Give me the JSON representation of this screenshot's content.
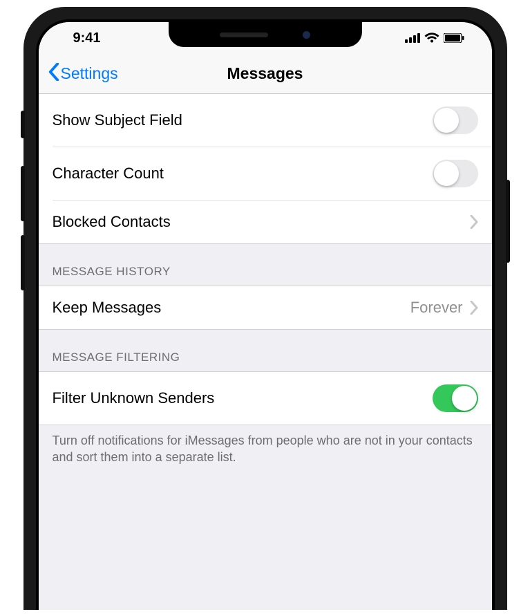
{
  "status": {
    "time": "9:41"
  },
  "nav": {
    "back": "Settings",
    "title": "Messages"
  },
  "group1": {
    "rows": [
      {
        "label": "Show Subject Field",
        "type": "toggle",
        "on": false
      },
      {
        "label": "Character Count",
        "type": "toggle",
        "on": false
      },
      {
        "label": "Blocked Contacts",
        "type": "link"
      }
    ]
  },
  "group2": {
    "header": "MESSAGE HISTORY",
    "rows": [
      {
        "label": "Keep Messages",
        "type": "link",
        "value": "Forever"
      }
    ]
  },
  "group3": {
    "header": "MESSAGE FILTERING",
    "rows": [
      {
        "label": "Filter Unknown Senders",
        "type": "toggle",
        "on": true
      }
    ],
    "footer": "Turn off notifications for iMessages from people who are not in your contacts and sort them into a separate list."
  }
}
